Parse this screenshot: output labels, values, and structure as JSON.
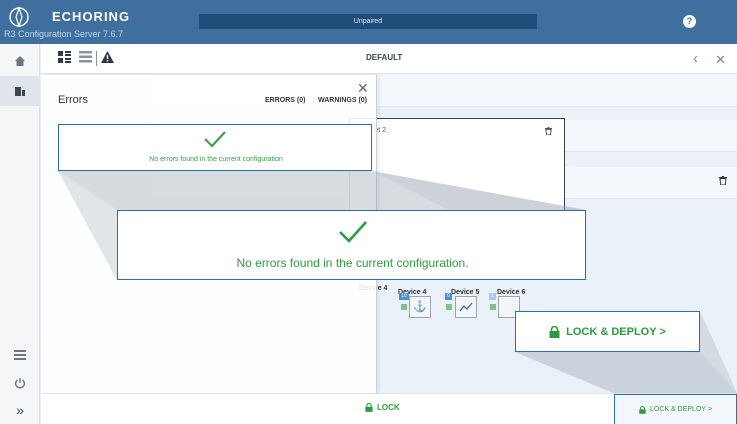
{
  "header": {
    "brand": "ECHORING",
    "subtitle": "R3 Configuration Server 7.6.7",
    "status": "Unpaired",
    "help_icon": "?"
  },
  "toolbar": {
    "view_label": "DEFAULT"
  },
  "errors_panel": {
    "title": "Errors",
    "errors_count": "ERRORS (0)",
    "warnings_count": "WARNINGS (0)",
    "message": "No errors found in the current configuration"
  },
  "zoom": {
    "message": "No errors found in the current configuration.",
    "deploy_label": "LOCK & DEPLOY >"
  },
  "subnet": {
    "title": "Subnet 2",
    "devices": [
      {
        "name": "Device 4",
        "badge": "10"
      },
      {
        "name": "Device 5",
        "badge": "0"
      },
      {
        "name": "Device 6",
        "badge": "1"
      }
    ]
  },
  "footer": {
    "lock_label": "LOCK",
    "deploy_label": "LOCK & DEPLOY >"
  },
  "colors": {
    "header": "#3f6f9e",
    "accent_green": "#2f9b41",
    "highlight_blue": "#2a6eb0"
  }
}
